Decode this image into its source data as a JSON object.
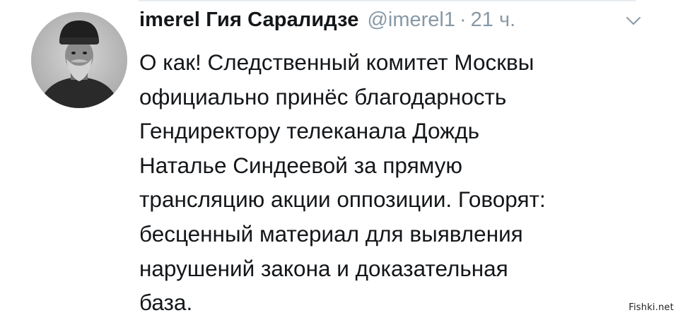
{
  "tweet": {
    "author": {
      "display_name": "imerel Гия Саралидзе",
      "handle": "@imerel1",
      "avatar_icon": "avatar-portrait-old-man-fur-hat"
    },
    "separator": "·",
    "timestamp": "21 ч.",
    "menu_icon": "chevron-down-icon",
    "text": "О как! Следственный комитет  Москвы\nофициально принёс благодарность\nГендиректору телеканала Дождь\nНаталье Синдеевой за прямую\nтрансляцию акции оппозиции. Говорят:\nбесценный материал для выявления\nнарушений закона и доказательная\nбаза."
  },
  "watermark": "Fishki.net",
  "colors": {
    "text": "#14171a",
    "secondary": "#8899a6",
    "background": "#ffffff",
    "divider": "#e6ecf0"
  }
}
